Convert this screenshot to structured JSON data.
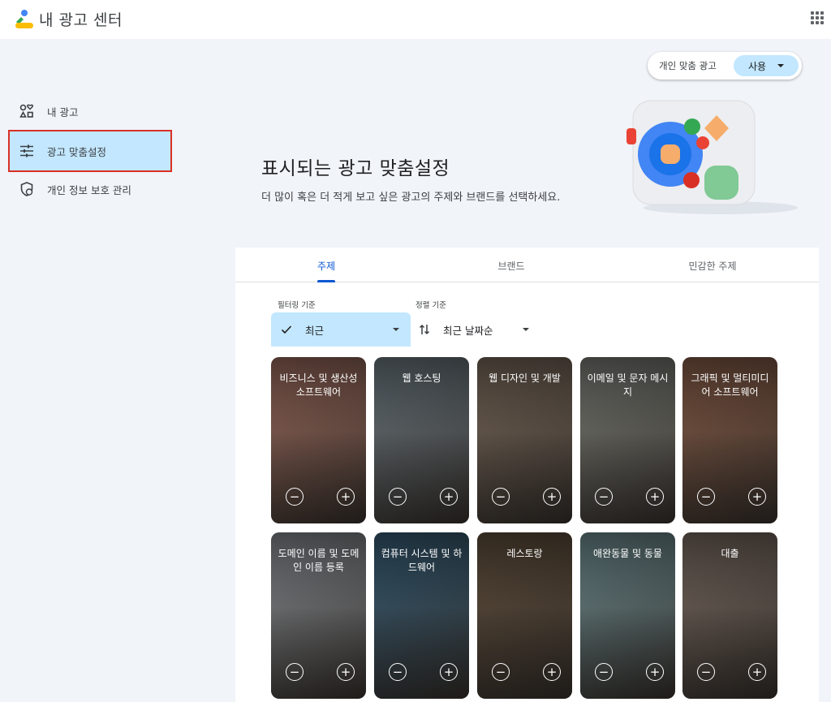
{
  "header": {
    "app_title": "내 광고 센터",
    "apps_icon": "apps-grid-icon"
  },
  "sidebar": {
    "items": [
      {
        "label": "내 광고",
        "icon": "my-ads-icon"
      },
      {
        "label": "광고 맞춤설정",
        "icon": "tune-icon",
        "active": true
      },
      {
        "label": "개인 정보 보호 관리",
        "icon": "privacy-shield-icon"
      }
    ]
  },
  "consent": {
    "label": "개인 맞춤 광고",
    "value": "사용"
  },
  "hero": {
    "title": "표시되는 광고 맞춤설정",
    "subtitle": "더 많이 혹은 더 적게 보고 싶은 광고의 주제와 브랜드를 선택하세요."
  },
  "tabs": [
    {
      "label": "주제",
      "active": true
    },
    {
      "label": "브랜드"
    },
    {
      "label": "민감한 주제"
    }
  ],
  "filters": {
    "filter_label": "필터링 기준",
    "filter_value": "최근",
    "sort_label": "정렬 기준",
    "sort_value": "최근 날짜순"
  },
  "topics": [
    {
      "title": "비즈니스 및 생산성 소프트웨어",
      "color": "#b07a6a"
    },
    {
      "title": "웹 호스팅",
      "color": "#7c8a93"
    },
    {
      "title": "웹 디자인 및 개발",
      "color": "#8a7868"
    },
    {
      "title": "이메일 및 문자 메시지",
      "color": "#8d9088"
    },
    {
      "title": "그래픽 및 멀티미디어 소프트웨어",
      "color": "#9a6a52"
    },
    {
      "title": "도메인 이름 및 도메인 이름 등록",
      "color": "#9aa0a6"
    },
    {
      "title": "컴퓨터 시스템 및 하드웨어",
      "color": "#3f6a86"
    },
    {
      "title": "레스토랑",
      "color": "#6e5a45"
    },
    {
      "title": "애완동물 및 동물",
      "color": "#7fa1a6"
    },
    {
      "title": "대출",
      "color": "#8a7a70"
    }
  ]
}
